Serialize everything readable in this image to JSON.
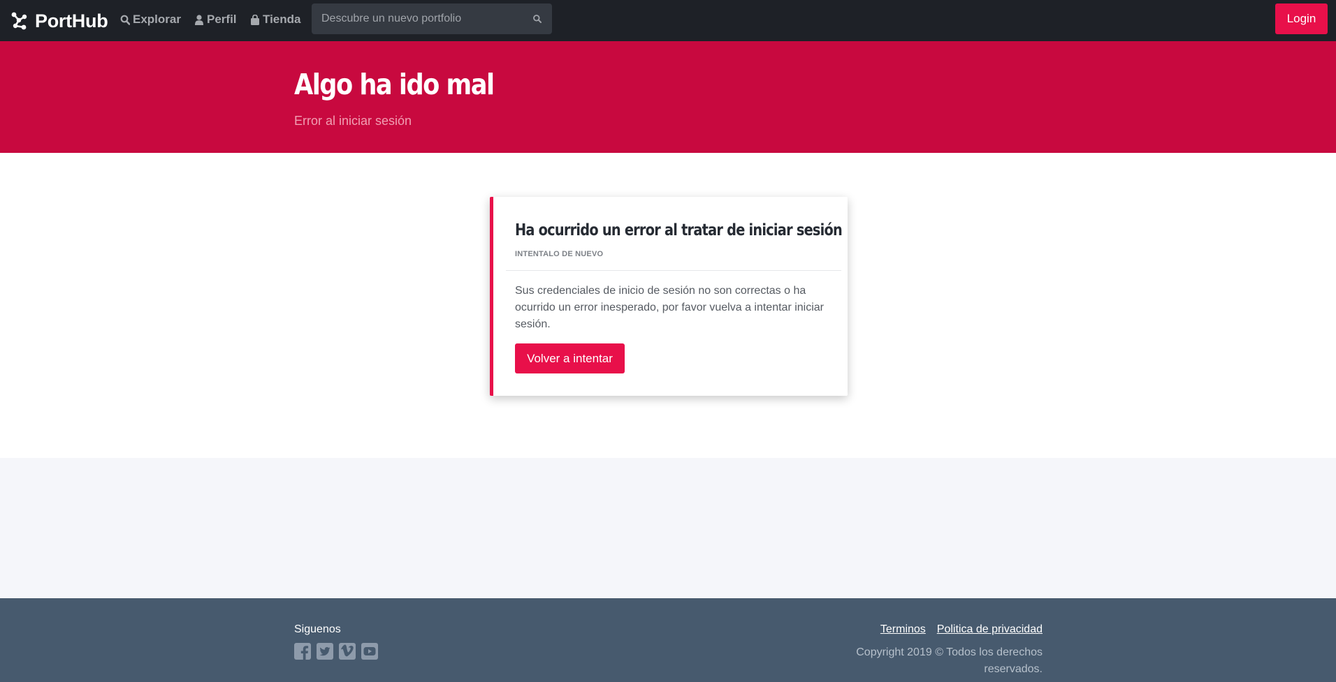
{
  "navbar": {
    "brand": "PortHub",
    "items": [
      {
        "label": "Explorar",
        "icon": "search-icon"
      },
      {
        "label": "Perfil",
        "icon": "user-icon"
      },
      {
        "label": "Tienda",
        "icon": "shopping-bag-icon"
      }
    ],
    "search_placeholder": "Descubre un nuevo portfolio",
    "login_label": "Login"
  },
  "hero": {
    "title": "Algo ha ido mal",
    "subtitle": "Error al iniciar sesión"
  },
  "card": {
    "title": "Ha ocurrido un error al tratar de iniciar sesión",
    "subtitle": "INTENTALO DE NUEVO",
    "message": "Sus credenciales de inicio de sesión no son correctas o ha ocurrido un error inesperado, por favor vuelva a intentar iniciar sesión.",
    "button_label": "Volver a intentar"
  },
  "footer": {
    "follow_label": "Siguenos",
    "social_icons": [
      "facebook-icon",
      "twitter-icon",
      "vimeo-icon",
      "youtube-icon"
    ],
    "links": [
      "Terminos",
      "Politica de privacidad"
    ],
    "copyright": "Copyright 2019 © Todos los derechos reservados."
  },
  "colors": {
    "navbar_bg": "#1e2127",
    "accent": "#e8104a",
    "hero_bg": "#c8093f",
    "footer_bg": "#475a6e",
    "page_bg": "#f5f6fa"
  }
}
